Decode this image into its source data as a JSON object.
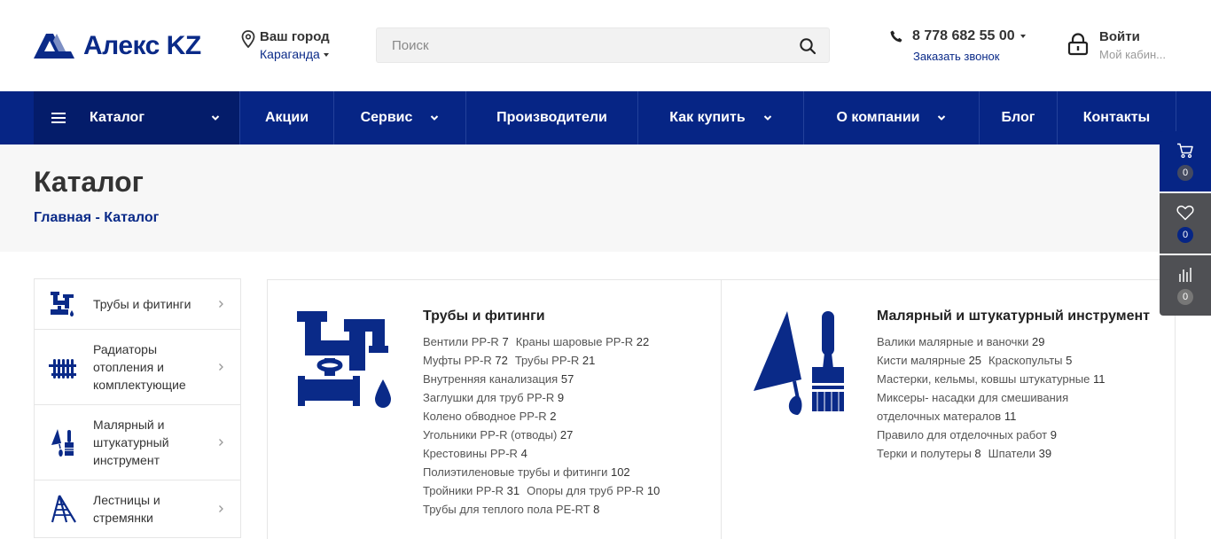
{
  "header": {
    "logo_text": "Алекс KZ",
    "city_label": "Ваш город",
    "city_value": "Караганда",
    "search_placeholder": "Поиск",
    "phone": "8 778 682 55 00",
    "callback": "Заказать звонок",
    "login_label": "Войти",
    "login_sub": "Мой кабин..."
  },
  "nav": {
    "catalog": "Каталог",
    "items": [
      "Акции",
      "Сервис",
      "Производители",
      "Как купить",
      "О компании",
      "Блог",
      "Контакты"
    ]
  },
  "page": {
    "title": "Каталог",
    "breadcrumb_home": "Главная",
    "breadcrumb_sep": " - ",
    "breadcrumb_current": "Каталог"
  },
  "sidebar": {
    "items": [
      {
        "label": "Трубы и фитинги",
        "icon": "pipes-icon"
      },
      {
        "label": "Радиаторы отопления и комплектующие",
        "icon": "radiator-icon"
      },
      {
        "label": "Малярный и штукатурный инструмент",
        "icon": "trowel-brush-icon"
      },
      {
        "label": "Лестницы и стремянки",
        "icon": "ladder-icon"
      }
    ]
  },
  "cards": [
    {
      "title": "Трубы и фитинги",
      "icon": "pipes-icon",
      "subs": [
        [
          {
            "name": "Вентили PP-R",
            "count": "7"
          },
          {
            "name": "Краны шаровые PP-R",
            "count": "22"
          }
        ],
        [
          {
            "name": "Муфты PP-R",
            "count": "72"
          },
          {
            "name": "Трубы PP-R",
            "count": "21"
          }
        ],
        [
          {
            "name": "Внутренняя канализация",
            "count": "57"
          }
        ],
        [
          {
            "name": "Заглушки для труб PP-R",
            "count": "9"
          }
        ],
        [
          {
            "name": "Колено обводное PP-R",
            "count": "2"
          }
        ],
        [
          {
            "name": "Угольники PP-R (отводы)",
            "count": "27"
          }
        ],
        [
          {
            "name": "Крестовины PP-R",
            "count": "4"
          }
        ],
        [
          {
            "name": "Полиэтиленовые трубы и фитинги",
            "count": "102"
          }
        ],
        [
          {
            "name": "Тройники PP-R",
            "count": "31"
          },
          {
            "name": "Опоры для труб PP-R",
            "count": "10"
          }
        ],
        [
          {
            "name": "Трубы для теплого пола PE-RT",
            "count": "8"
          }
        ]
      ]
    },
    {
      "title": "Малярный и штукатурный инструмент",
      "icon": "trowel-brush-icon",
      "subs": [
        [
          {
            "name": "Валики малярные и ваночки",
            "count": "29"
          }
        ],
        [
          {
            "name": "Кисти малярные",
            "count": "25"
          },
          {
            "name": "Краскопульты",
            "count": "5"
          }
        ],
        [
          {
            "name": "Мастерки, кельмы, ковшы штукатурные",
            "count": "11"
          }
        ],
        [
          {
            "name": "Миксеры- насадки для смешивания",
            "count": ""
          }
        ],
        [
          {
            "name": "отделочных матералов",
            "count": "11"
          }
        ],
        [
          {
            "name": "Правило для отделочных работ",
            "count": "9"
          }
        ],
        [
          {
            "name": "Терки и полутеры",
            "count": "8"
          },
          {
            "name": "Шпатели",
            "count": "39"
          }
        ]
      ]
    }
  ],
  "float_panel": {
    "cart_count": "0",
    "fav_count": "0",
    "compare_count": "0"
  },
  "colors": {
    "brand": "#062585",
    "nav_dark": "#041c6a"
  }
}
